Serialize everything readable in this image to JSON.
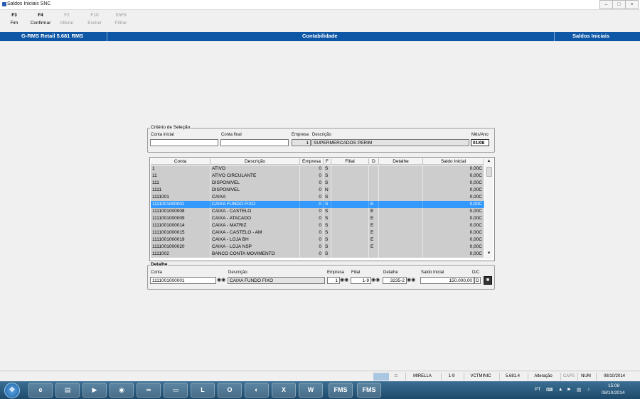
{
  "window": {
    "title": "Saldos Iniciais SNC"
  },
  "toolbar": [
    {
      "key": "F3",
      "label": "Fim",
      "enabled": true
    },
    {
      "key": "F4",
      "label": "Confirmar",
      "enabled": true
    },
    {
      "key": "F2",
      "label": "Alterar",
      "enabled": false
    },
    {
      "key": "F10",
      "label": "Excluir",
      "enabled": false
    },
    {
      "key": "ShF9",
      "label": "Filtrar",
      "enabled": false
    }
  ],
  "bluebar": {
    "app": "G-RMS Retail 5.681 RMS",
    "module": "Contabilidade",
    "screen": "Saldos Iniciais"
  },
  "criteria": {
    "legend": "Critério de Seleção",
    "conta_inicial_label": "Conta inicial",
    "conta_inicial_value": "",
    "conta_final_label": "Conta final",
    "conta_final_value": "",
    "empresa_label": "Empresa",
    "empresa_value": "1",
    "descricao_label": "Descrição",
    "descricao_value": "SUPERMERCADOS PERIM",
    "mesano_label": "Mês/Ano",
    "mesano_value": "01/08"
  },
  "grid": {
    "headers": [
      "Conta",
      "Descrição",
      "Empresa",
      "F",
      "Filial",
      "D",
      "Detalhe",
      "Saldo Inicial"
    ],
    "selected_index": 5,
    "rows": [
      [
        "1",
        "ATIVO",
        "0",
        "S",
        "",
        "",
        "",
        "0,00C"
      ],
      [
        "11",
        "ATIVO CIRCULANTE",
        "0",
        "S",
        "",
        "",
        "",
        "0,00C"
      ],
      [
        "111",
        "DISPONIVEL",
        "0",
        "S",
        "",
        "",
        "",
        "0,00C"
      ],
      [
        "1111",
        "DISPONIVEL",
        "0",
        "N",
        "",
        "",
        "",
        "0,00C"
      ],
      [
        "1111001",
        "CAIXA",
        "0",
        "S",
        "",
        "",
        "",
        "0,00C"
      ],
      [
        "1111001000001",
        "CAIXA FUNDO FIXO",
        "0",
        "S",
        "",
        "E",
        "",
        "0,00C"
      ],
      [
        "1111001000008",
        "CAIXA - CASTELO",
        "0",
        "S",
        "",
        "E",
        "",
        "0,00C"
      ],
      [
        "1111001000009",
        "CAIXA - ATACADO",
        "0",
        "S",
        "",
        "E",
        "",
        "0,00C"
      ],
      [
        "1111001000014",
        "CAIXA - MATRIZ",
        "0",
        "S",
        "",
        "E",
        "",
        "0,00C"
      ],
      [
        "1111001000015",
        "CAIXA - CASTELO - AM",
        "0",
        "S",
        "",
        "E",
        "",
        "0,00C"
      ],
      [
        "1111001000019",
        "CAIXA - LOJA BH",
        "0",
        "S",
        "",
        "E",
        "",
        "0,00C"
      ],
      [
        "1111001000020",
        "CAIXA - LOJA NSP",
        "0",
        "S",
        "",
        "E",
        "",
        "0,00C"
      ],
      [
        "1111002",
        "BANCO CONTA MOVIMENTO",
        "0",
        "S",
        "",
        "",
        "",
        "0,00C"
      ]
    ]
  },
  "detail": {
    "legend": "Detalhe",
    "conta_label": "Conta",
    "conta_value": "1111001000001",
    "descricao_label": "Descrição",
    "descricao_value": "CAIXA FUNDO FIXO",
    "empresa_label": "Empresa",
    "empresa_value": "1",
    "filial_label": "Filial",
    "filial_value": "1-9",
    "detalhe_label": "Detalhe",
    "detalhe_value": "3235-2",
    "saldo_label": "Saldo Inicial",
    "saldo_value": "150.000,00",
    "dc_label": "D/C",
    "dc_value": "D"
  },
  "statusbar": {
    "user": "MIRELLA",
    "filial": "1-9",
    "program": "VCTMINIC",
    "version": "5.681.4",
    "mode": "Alteração",
    "caps": "CAPS",
    "num": "NUM",
    "date": "08/10/2014"
  },
  "taskbar": {
    "apps": [
      "FMS",
      "FMS"
    ],
    "lang": "PT",
    "time": "15:08",
    "date": "08/10/2014"
  },
  "icons": {
    "binoculars": "binoculars-icon",
    "save": "save-icon"
  }
}
